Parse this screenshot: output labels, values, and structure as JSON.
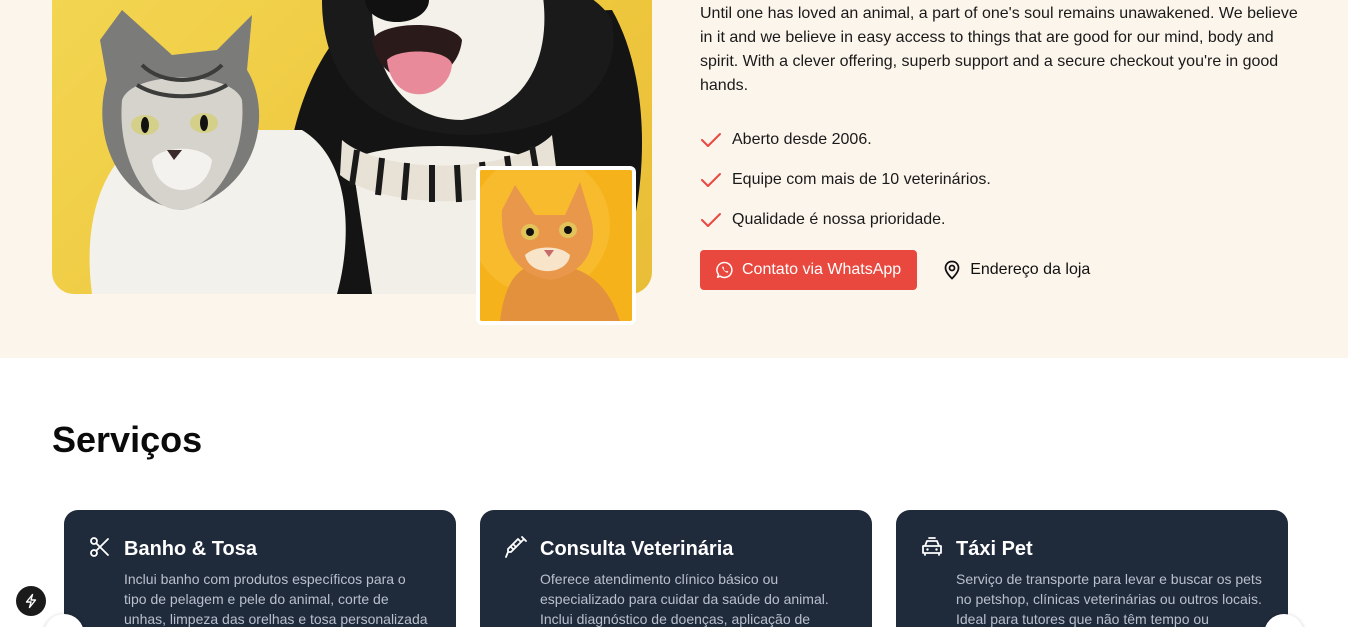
{
  "about": {
    "text": "Until one has loved an animal, a part of one's soul remains unawakened. We believe in it and we believe in easy access to things that are good for our mind, body and spirit. With a clever offering, superb support and a secure checkout you're in good hands.",
    "features": [
      {
        "label": "Aberto desde 2006."
      },
      {
        "label": "Equipe com mais de 10 veterinários."
      },
      {
        "label": "Qualidade é nossa prioridade."
      }
    ],
    "whatsapp_button": "Contato via WhatsApp",
    "store_link": "Endereço da loja"
  },
  "services": {
    "title": "Serviços",
    "cards": [
      {
        "icon": "scissors-icon",
        "title": "Banho & Tosa",
        "description": "Inclui banho com produtos específicos para o tipo de pelagem e pele do animal, corte de unhas, limpeza das orelhas e tosa personalizada"
      },
      {
        "icon": "syringe-icon",
        "title": "Consulta Veterinária",
        "description": "Oferece atendimento clínico básico ou especializado para cuidar da saúde do animal. Inclui diagnóstico de doenças, aplicação de"
      },
      {
        "icon": "taxi-icon",
        "title": "Táxi Pet",
        "description": "Serviço de transporte para levar e buscar os pets no petshop, clínicas veterinárias ou outros locais. Ideal para tutores que não têm tempo ou"
      }
    ]
  },
  "colors": {
    "hero_bg": "#fcf5ec",
    "accent": "#e9483e",
    "card_bg": "#1f2a3b"
  }
}
